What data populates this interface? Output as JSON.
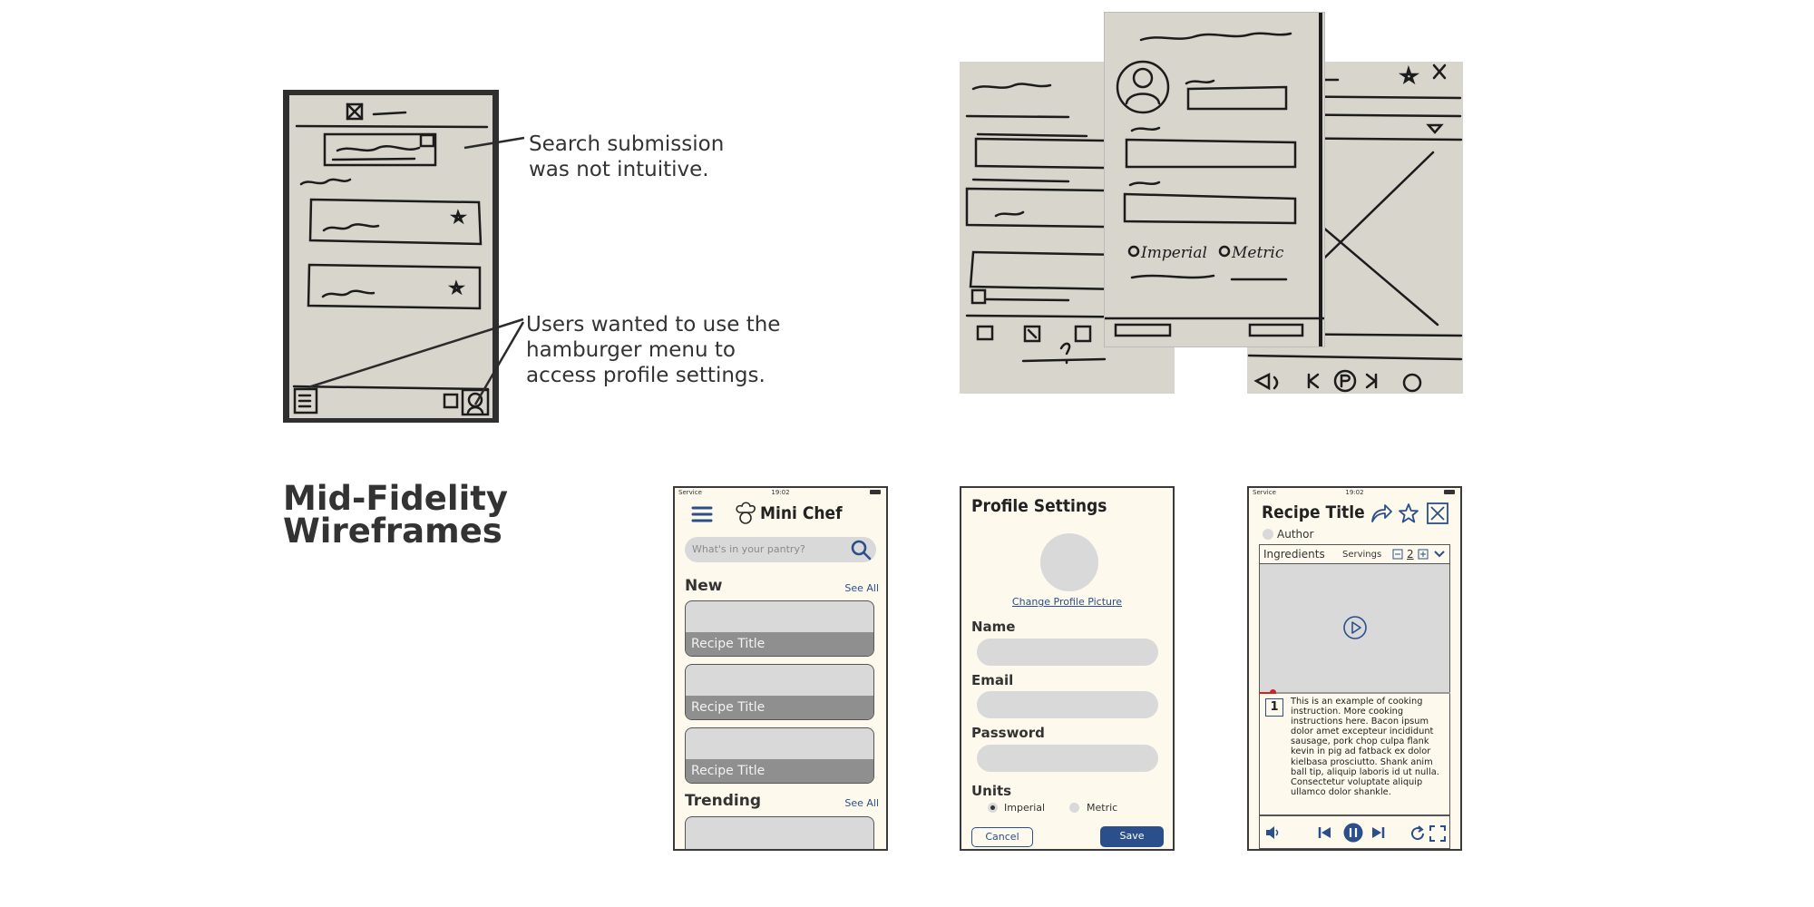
{
  "annotations": {
    "search": "Search submission\nwas not intuitive.",
    "hamburger": "Users wanted to use the\nhamburger menu to\naccess profile settings."
  },
  "section_title": "Mid-Fidelity\nWireframes",
  "sketch_labels": {
    "imperial": "Imperial",
    "metric": "Metric"
  },
  "home": {
    "status_service": "Service",
    "status_time": "19:02",
    "app_name": "Mini Chef",
    "search_placeholder": "What's in your pantry?",
    "new_label": "New",
    "see_all": "See All",
    "cards": [
      "Recipe Title",
      "Recipe Title",
      "Recipe Title"
    ],
    "trending_label": "Trending",
    "trending_see_all": "See All"
  },
  "profile": {
    "title": "Profile Settings",
    "change_picture": "Change Profile Picture",
    "name_label": "Name",
    "email_label": "Email",
    "password_label": "Password",
    "units_label": "Units",
    "units_options": [
      "Imperial",
      "Metric"
    ],
    "units_selected": "Imperial",
    "cancel": "Cancel",
    "save": "Save"
  },
  "recipe": {
    "status_service": "Service",
    "status_time": "19:02",
    "title": "Recipe Title",
    "author": "Author",
    "ingredients": "Ingredients",
    "servings_label": "Servings",
    "servings_value": "2",
    "step_number": "1",
    "step_text": "This is an example of cooking instruction. More cooking instructions here. Bacon ipsum dolor amet excepteur incididunt sausage, pork chop culpa flank kevin in pig ad fatback ex dolor kielbasa prosciutto. Shank anim ball tip, aliquip laboris id ut nulla. Consectetur voluptate aliquip ullamco dolor shankle.",
    "video_progress": 0.07
  },
  "colors": {
    "accent": "#2b4f8a",
    "phone_bg": "#fdf9ec",
    "placeholder_gray": "#d9d9d9",
    "card_band": "#8f8f8f"
  }
}
